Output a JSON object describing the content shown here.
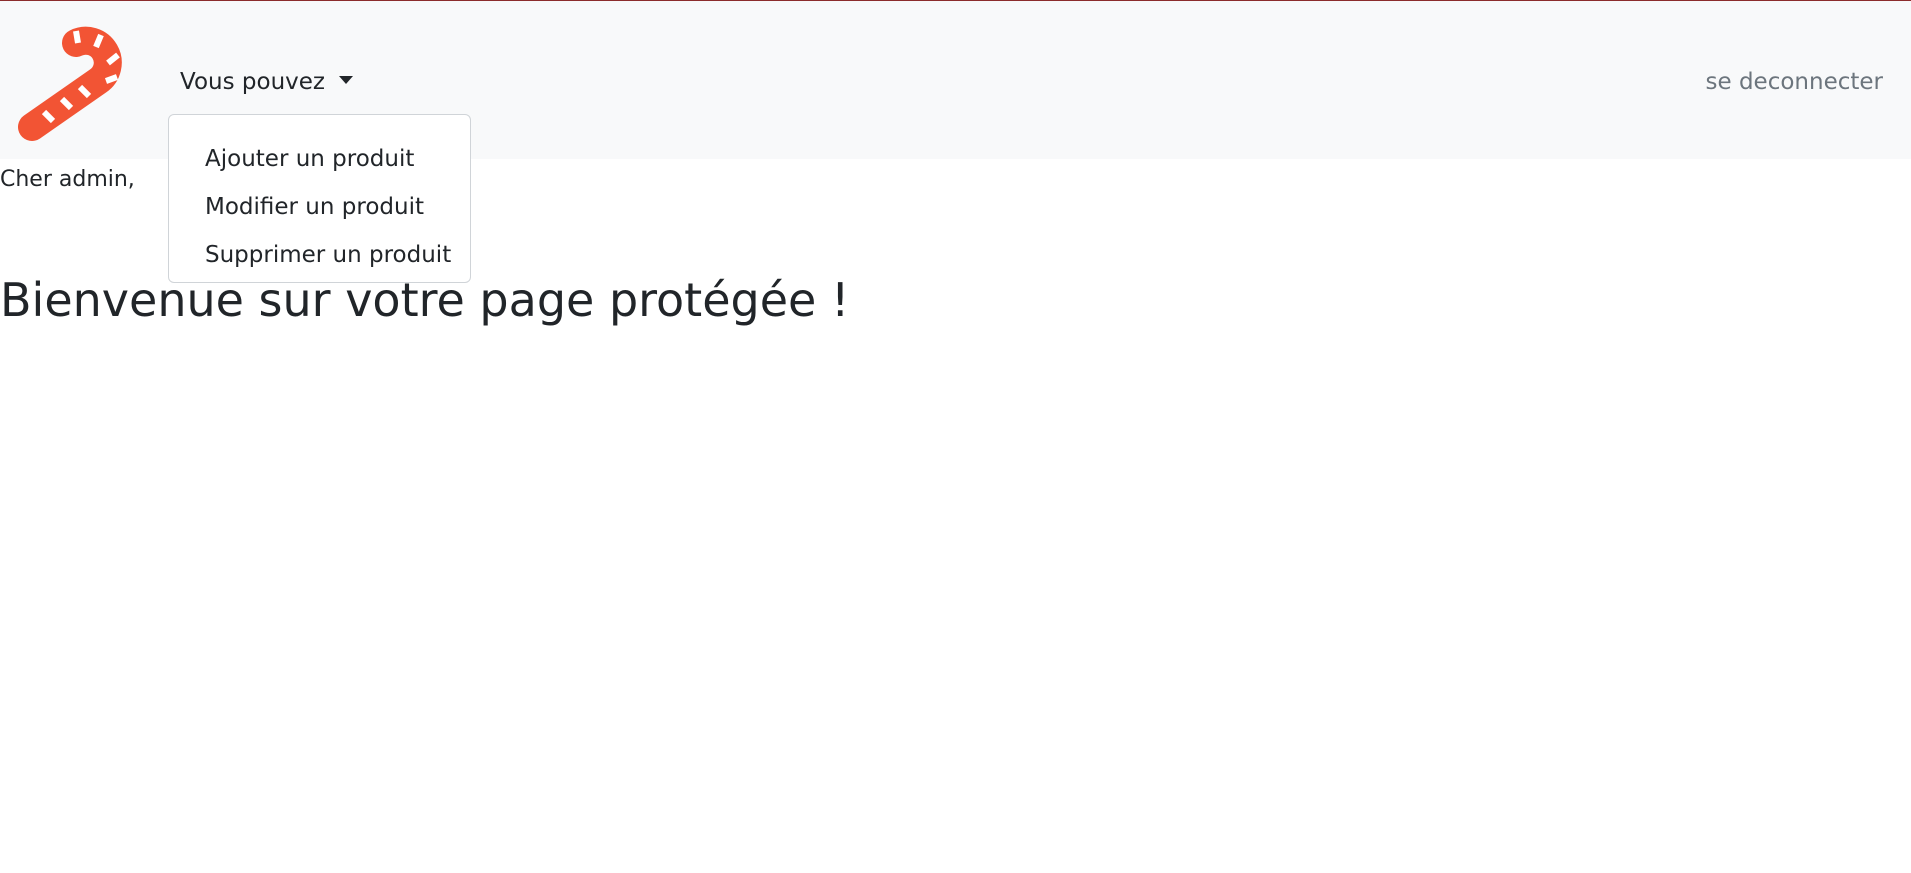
{
  "brand": {
    "logo_icon": "candy-cane-icon",
    "color": "#f25434"
  },
  "nav": {
    "dropdown_label": "Vous pouvez",
    "dropdown_items": [
      {
        "label": "Ajouter un produit"
      },
      {
        "label": "Modifier un produit"
      },
      {
        "label": "Supprimer un produit"
      }
    ],
    "logout_label": "se deconnecter"
  },
  "main": {
    "greeting": "Cher admin,",
    "title": "Bienvenue sur votre page protégée !"
  }
}
